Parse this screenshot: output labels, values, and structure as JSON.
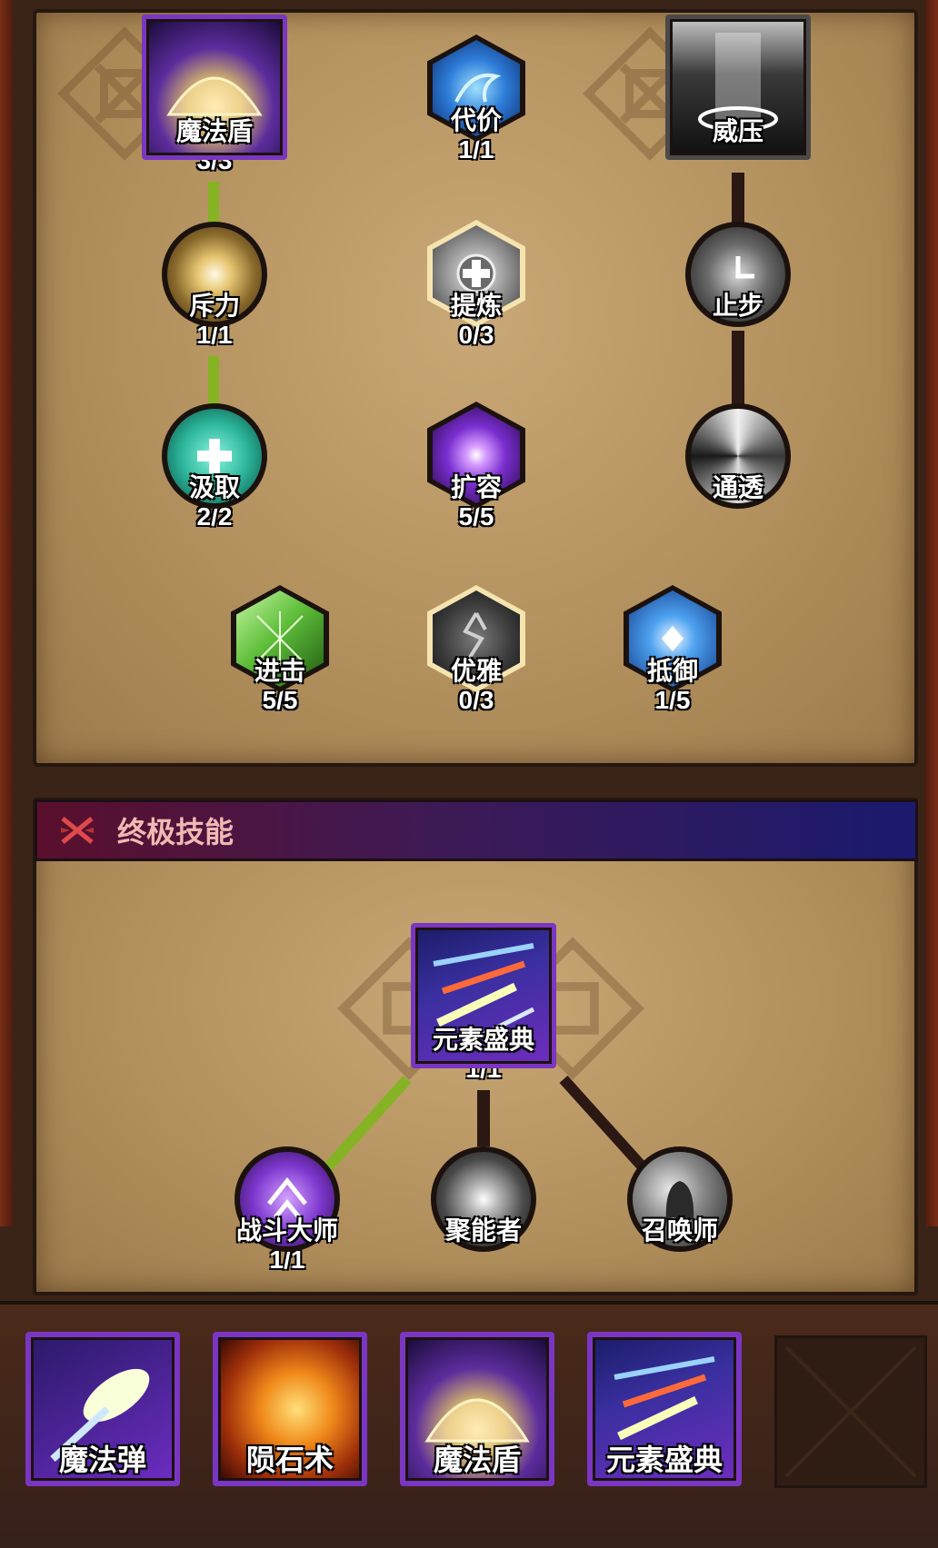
{
  "skill_tree": {
    "nodes": [
      {
        "id": "magic_shield",
        "name": "魔法盾",
        "count": "3/3",
        "shape": "square",
        "icon": "shield-dome-icon"
      },
      {
        "id": "price",
        "name": "代价",
        "count": "1/1",
        "shape": "hex",
        "icon": "blue-aura-icon"
      },
      {
        "id": "pressure",
        "name": "威压",
        "count": "",
        "shape": "square",
        "icon": "light-pillar-icon"
      },
      {
        "id": "repel",
        "name": "斥力",
        "count": "1/1",
        "shape": "circle",
        "icon": "golden-burst-icon"
      },
      {
        "id": "refine",
        "name": "提炼",
        "count": "0/3",
        "shape": "hex",
        "icon": "plus-badge-icon"
      },
      {
        "id": "halt",
        "name": "止步",
        "count": "",
        "shape": "circle",
        "icon": "clock-icon"
      },
      {
        "id": "drain",
        "name": "汲取",
        "count": "2/2",
        "shape": "circle",
        "icon": "heal-cross-icon"
      },
      {
        "id": "expand",
        "name": "扩容",
        "count": "5/5",
        "shape": "hex",
        "icon": "purple-orb-icon"
      },
      {
        "id": "pierce",
        "name": "通透",
        "count": "",
        "shape": "circle",
        "icon": "swirl-icon"
      },
      {
        "id": "advance",
        "name": "进击",
        "count": "5/5",
        "shape": "hex",
        "icon": "green-shatter-icon"
      },
      {
        "id": "grace",
        "name": "优雅",
        "count": "0/3",
        "shape": "hex",
        "icon": "rune-icon"
      },
      {
        "id": "resist",
        "name": "抵御",
        "count": "1/5",
        "shape": "hex",
        "icon": "blue-vortex-icon"
      }
    ]
  },
  "ultimate": {
    "header": "终极技能",
    "main": {
      "name": "元素盛典",
      "count": "1/1",
      "icon": "meteor-shower-icon"
    },
    "subs": [
      {
        "name": "战斗大师",
        "count": "1/1",
        "icon": "purple-chevron-icon"
      },
      {
        "name": "聚能者",
        "count": "",
        "icon": "white-burst-icon"
      },
      {
        "name": "召唤师",
        "count": "",
        "icon": "ghost-icon"
      }
    ]
  },
  "skill_bar": [
    {
      "name": "魔法弹",
      "icon": "magic-bolt-icon"
    },
    {
      "name": "陨石术",
      "icon": "meteor-icon"
    },
    {
      "name": "魔法盾",
      "icon": "shield-dome-icon"
    },
    {
      "name": "元素盛典",
      "icon": "meteor-shower-icon"
    }
  ],
  "colors": {
    "active_link": "#86b324",
    "inactive_link": "#2b1812",
    "ultimate_purple": "#7a36c2"
  }
}
